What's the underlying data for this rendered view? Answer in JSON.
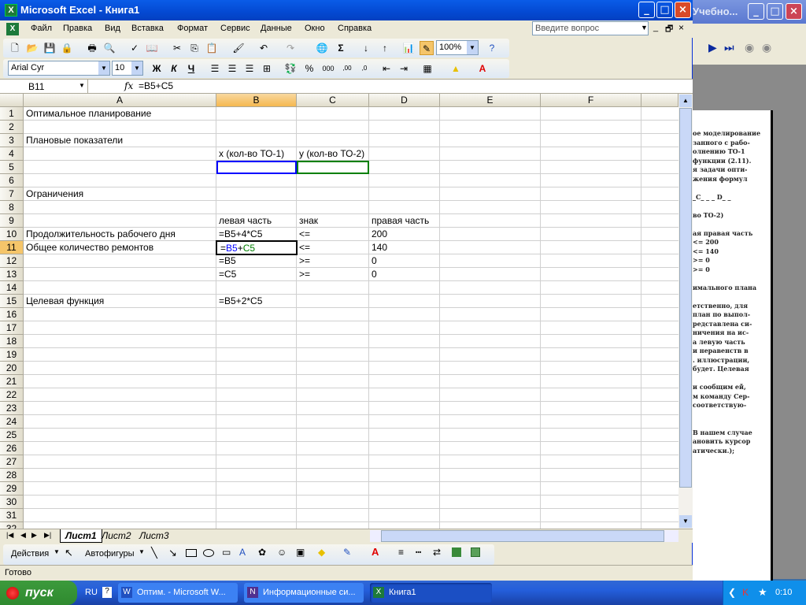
{
  "window": {
    "title": "Microsoft Excel - Книга1"
  },
  "bgwin": {
    "title": "Учебно...",
    "lines": [
      "ое моделирование",
      "занного с рабо-",
      "олнению ТО-1",
      "функции (2.11).",
      "я задачи опти-",
      "жения формул",
      "",
      "_C_ _ _ D_ _",
      "",
      "во ТО-2)",
      "",
      "ая      правая часть",
      "<=       200",
      "<=       140",
      ">=       0",
      ">=       0",
      "",
      "имального плана",
      "",
      "етственно, для",
      "план по выпол-",
      "редставлена си-",
      "ничения на ис-",
      "а левую часть",
      "и неравенств в",
      ". иллюстрации,",
      "будет. Целевая",
      "",
      "и сообщим ей,",
      "м команду Сер-",
      "соответствую-",
      "",
      "",
      "В нашем случае",
      "ановить курсор",
      "атически.);"
    ]
  },
  "menu": [
    "Файл",
    "Правка",
    "Вид",
    "Вставка",
    "Формат",
    "Сервис",
    "Данные",
    "Окно",
    "Справка"
  ],
  "help_placeholder": "Введите вопрос",
  "zoom": "100%",
  "font_name": "Arial Cyr",
  "font_size": "10",
  "format_buttons": {
    "bold": "Ж",
    "italic": "К",
    "underline": "Ч"
  },
  "name_box": "B11",
  "fx": "fx",
  "formula": "=B5+C5",
  "columns": [
    "A",
    "B",
    "C",
    "D",
    "E",
    "F"
  ],
  "rows": [
    "1",
    "2",
    "3",
    "4",
    "5",
    "6",
    "7",
    "8",
    "9",
    "10",
    "11",
    "12",
    "13",
    "14",
    "15",
    "16",
    "17",
    "18",
    "19",
    "20",
    "21",
    "22",
    "23",
    "24",
    "25",
    "26",
    "27",
    "28",
    "29",
    "30",
    "31",
    "32"
  ],
  "cells": {
    "A1": "Оптимальное планирование",
    "A3": "Плановые показатели",
    "B4": "x (кол-во ТО-1)",
    "C4": "y (кол-во ТО-2)",
    "A7": "Ограничения",
    "B9": "левая часть",
    "C9": "знак",
    "D9": "правая часть",
    "A10": "Продолжительность рабочего дня",
    "B10": "=B5+4*C5",
    "C10": "<=",
    "D10": "200",
    "A11": "Общее количество ремонтов",
    "B11a": "=",
    "B11b": "B5",
    "B11c": "+",
    "B11d": "C5",
    "C11": "<=",
    "D11": "140",
    "B12": "=B5",
    "C12": ">=",
    "D12": "0",
    "B13": "=C5",
    "C13": ">=",
    "D13": "0",
    "A15": "Целевая функция",
    "B15": "=B5+2*C5"
  },
  "sheets": [
    "Лист1",
    "Лист2",
    "Лист3"
  ],
  "draw": {
    "actions": "Действия",
    "autoshapes": "Автофигуры"
  },
  "status": "Готово",
  "taskbar": {
    "start": "пуск",
    "lang": "RU",
    "tasks": [
      "Оптим. - Microsoft W...",
      "Информационные си...",
      "Книга1"
    ],
    "clock": "0:10"
  },
  "colors": {
    "ref_blue": "#0000ff",
    "ref_green": "#008000",
    "title_blue": "#0449d2"
  }
}
